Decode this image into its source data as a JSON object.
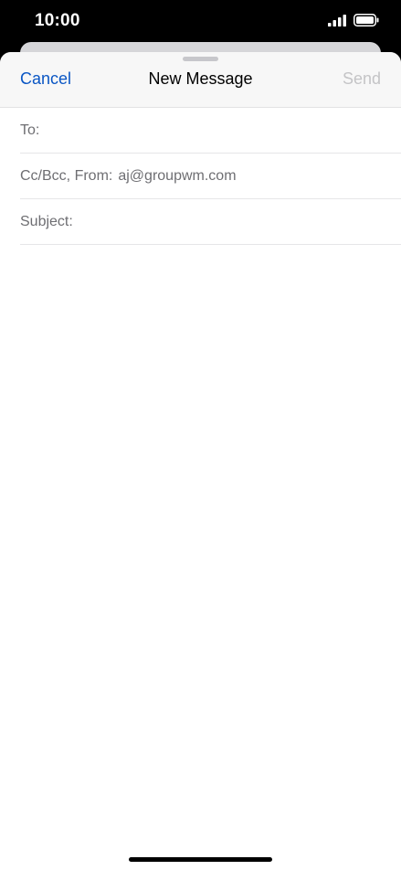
{
  "status_bar": {
    "time": "10:00",
    "icons": [
      "signal-icon",
      "battery-icon"
    ]
  },
  "compose": {
    "cancel_label": "Cancel",
    "title": "New Message",
    "send_label": "Send",
    "fields": {
      "to_label": "To:",
      "ccbcc_label": "Cc/Bcc, From:",
      "from_value": "aj@groupwm.com",
      "subject_label": "Subject:"
    }
  },
  "colors": {
    "accent": "#0a56c4",
    "disabled": "#c4c4c6",
    "field_text": "#6e6e72"
  }
}
